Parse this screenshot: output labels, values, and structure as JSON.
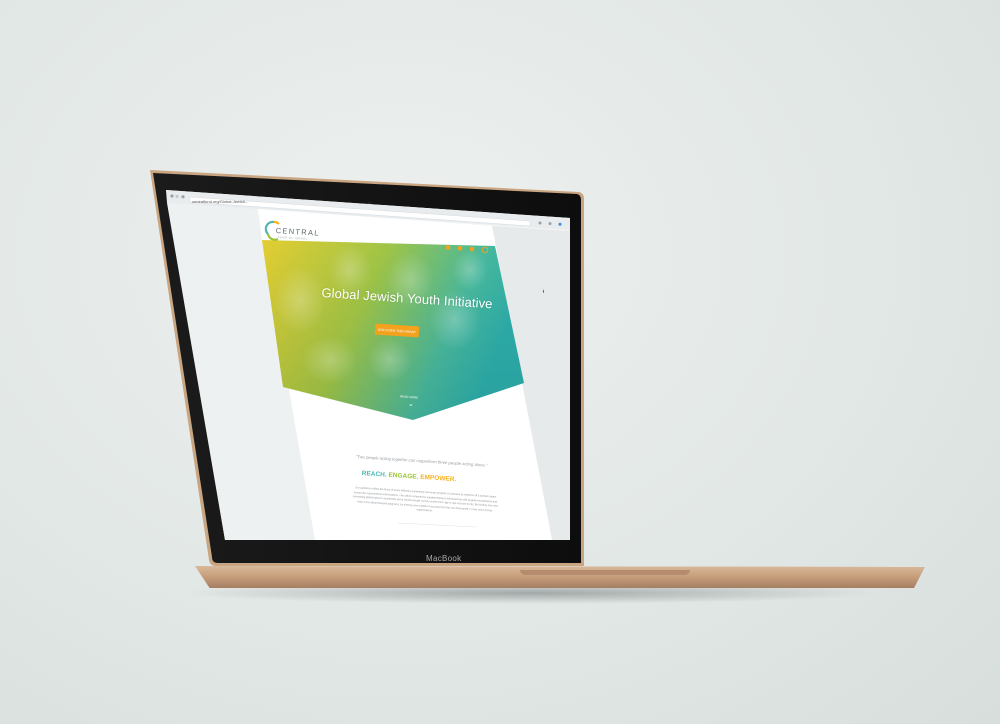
{
  "browser": {
    "url": "centralfund.org/Global-Jewish..."
  },
  "site": {
    "logo_text": "CENTRAL",
    "logo_sub": "FUND OF ISRAEL"
  },
  "hero": {
    "title": "Global Jewish Youth Initiative",
    "cta_label": "DISCOVER THIS GRANT",
    "scroll_label": "READ MORE"
  },
  "content": {
    "quote": "\"Two people acting together can outperform three people acting alone.\"",
    "tagline": {
      "part1": "REACH.",
      "part2": "ENGAGE.",
      "part3": "EMPOWER."
    },
    "paragraph": "Our guidance unifies the focus of every Affiliate's experience and every program it oversees to reinforce all 3 shared impact across the organizations and locations. The will be achieved by supplementing & infrastructure with targeted investments and connecting global ideas to seamlessly serve Jewish people as they evolve from age to age and city to city. By funding new and even more robust focused programs, by sharing new models of success that they are discovered, in over more across organizations."
  },
  "device": {
    "label": "MacBook"
  },
  "colors": {
    "accent_orange": "#f4a21d",
    "teal": "#4fb7b2",
    "green": "#9cc33a",
    "yellow": "#f4b321",
    "laptop_gold": "#c9a07e"
  }
}
